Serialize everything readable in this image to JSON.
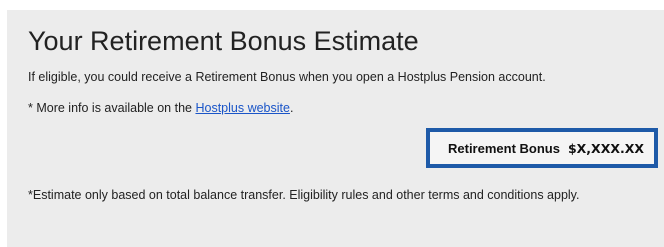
{
  "panel": {
    "title": "Your Retirement Bonus Estimate",
    "intro": "If eligible, you could receive a Retirement Bonus when you open a Hostplus Pension account.",
    "more_info_prefix": "* More info is available on the ",
    "more_info_link": "Hostplus website",
    "more_info_suffix": ".",
    "bonus": {
      "label": "Retirement Bonus",
      "value": "$X,XXX.XX"
    },
    "disclaimer": "*Estimate only based on total balance transfer. Eligibility rules and other terms and conditions apply."
  },
  "colors": {
    "panel_background": "#ececec",
    "accent_border": "#1e5aa8",
    "link": "#1a55c8"
  }
}
